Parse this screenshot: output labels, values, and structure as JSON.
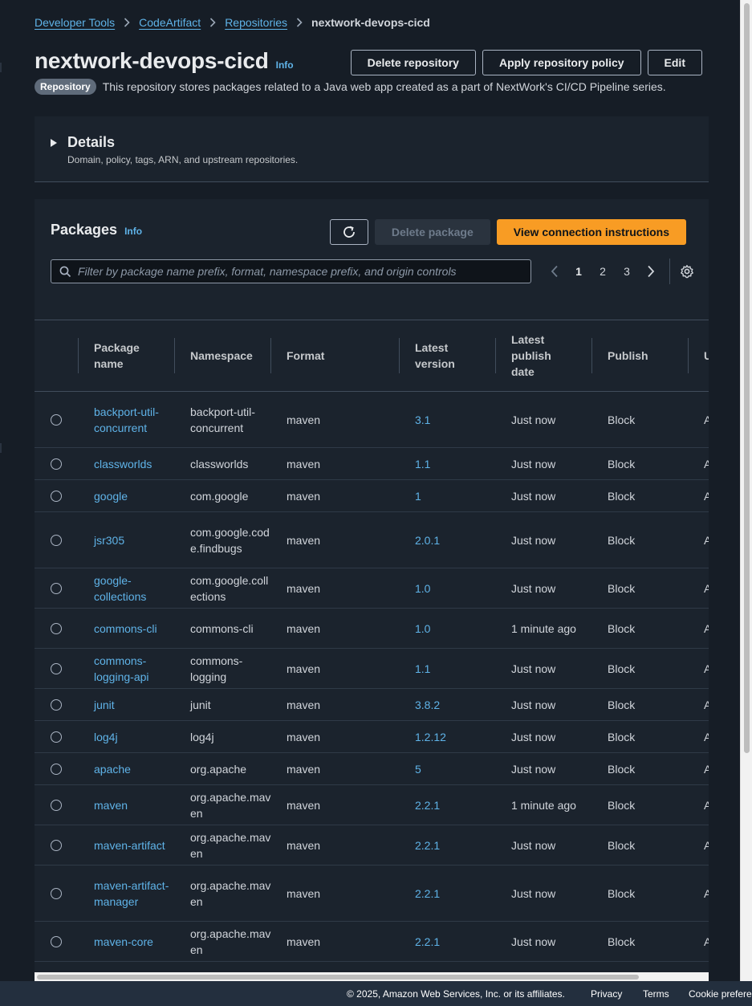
{
  "breadcrumb": {
    "items": [
      "Developer Tools",
      "CodeArtifact",
      "Repositories"
    ],
    "current": "nextwork-devops-cicd"
  },
  "header": {
    "title": "nextwork-devops-cicd",
    "info": "Info",
    "actions": {
      "delete_repository": "Delete repository",
      "apply_policy": "Apply repository policy",
      "edit": "Edit"
    },
    "badge": "Repository",
    "description": "This repository stores packages related to a Java web app created as a part of NextWork's CI/CD Pipeline series."
  },
  "details": {
    "title": "Details",
    "subtitle": "Domain, policy, tags, ARN, and upstream repositories."
  },
  "packages": {
    "title": "Packages",
    "info": "Info",
    "delete_package": "Delete package",
    "view_connection": "View connection instructions",
    "filter_placeholder": "Filter by package name prefix, format, namespace prefix, and origin controls",
    "pages": [
      "1",
      "2",
      "3"
    ],
    "active_page": "1",
    "columns": {
      "package_name": "Package name",
      "namespace": "Namespace",
      "format": "Format",
      "latest_version": "Latest version",
      "latest_publish_date": "Latest publish date",
      "publish": "Publish",
      "upstream_cut": "U"
    },
    "rows": [
      {
        "name": "backport-util-concurrent",
        "namespace": "backport-util-concurrent",
        "format": "maven",
        "version": "3.1",
        "date": "Just now",
        "publish": "Block",
        "cut": "A"
      },
      {
        "name": "classworlds",
        "namespace": "classworlds",
        "format": "maven",
        "version": "1.1",
        "date": "Just now",
        "publish": "Block",
        "cut": "A"
      },
      {
        "name": "google",
        "namespace": "com.google",
        "format": "maven",
        "version": "1",
        "date": "Just now",
        "publish": "Block",
        "cut": "A"
      },
      {
        "name": "jsr305",
        "namespace": "com.google.code.findbugs",
        "format": "maven",
        "version": "2.0.1",
        "date": "Just now",
        "publish": "Block",
        "cut": "A"
      },
      {
        "name": "google-collections",
        "namespace": "com.google.collections",
        "format": "maven",
        "version": "1.0",
        "date": "Just now",
        "publish": "Block",
        "cut": "A"
      },
      {
        "name": "commons-cli",
        "namespace": "commons-cli",
        "format": "maven",
        "version": "1.0",
        "date": "1 minute ago",
        "publish": "Block",
        "cut": "A"
      },
      {
        "name": "commons-logging-api",
        "namespace": "commons-logging",
        "format": "maven",
        "version": "1.1",
        "date": "Just now",
        "publish": "Block",
        "cut": "A"
      },
      {
        "name": "junit",
        "namespace": "junit",
        "format": "maven",
        "version": "3.8.2",
        "date": "Just now",
        "publish": "Block",
        "cut": "A"
      },
      {
        "name": "log4j",
        "namespace": "log4j",
        "format": "maven",
        "version": "1.2.12",
        "date": "Just now",
        "publish": "Block",
        "cut": "A"
      },
      {
        "name": "apache",
        "namespace": "org.apache",
        "format": "maven",
        "version": "5",
        "date": "Just now",
        "publish": "Block",
        "cut": "A"
      },
      {
        "name": "maven",
        "namespace": "org.apache.maven",
        "format": "maven",
        "version": "2.2.1",
        "date": "1 minute ago",
        "publish": "Block",
        "cut": "A"
      },
      {
        "name": "maven-artifact",
        "namespace": "org.apache.maven",
        "format": "maven",
        "version": "2.2.1",
        "date": "Just now",
        "publish": "Block",
        "cut": "A"
      },
      {
        "name": "maven-artifact-manager",
        "namespace": "org.apache.maven",
        "format": "maven",
        "version": "2.2.1",
        "date": "Just now",
        "publish": "Block",
        "cut": "A"
      },
      {
        "name": "maven-core",
        "namespace": "org.apache.maven",
        "format": "maven",
        "version": "2.2.1",
        "date": "Just now",
        "publish": "Block",
        "cut": "A"
      }
    ]
  },
  "footer": {
    "copyright": "© 2025, Amazon Web Services, Inc. or its affiliates.",
    "privacy": "Privacy",
    "terms": "Terms",
    "cookie": "Cookie preferences"
  },
  "colors": {
    "accent_link": "#5fb3e8",
    "primary_button": "#f89c24",
    "background": "#161d26",
    "card": "#1b232d"
  },
  "icons": [
    "chevron-right-icon",
    "refresh-icon",
    "search-icon",
    "chevron-left-icon",
    "settings-gear-icon"
  ]
}
